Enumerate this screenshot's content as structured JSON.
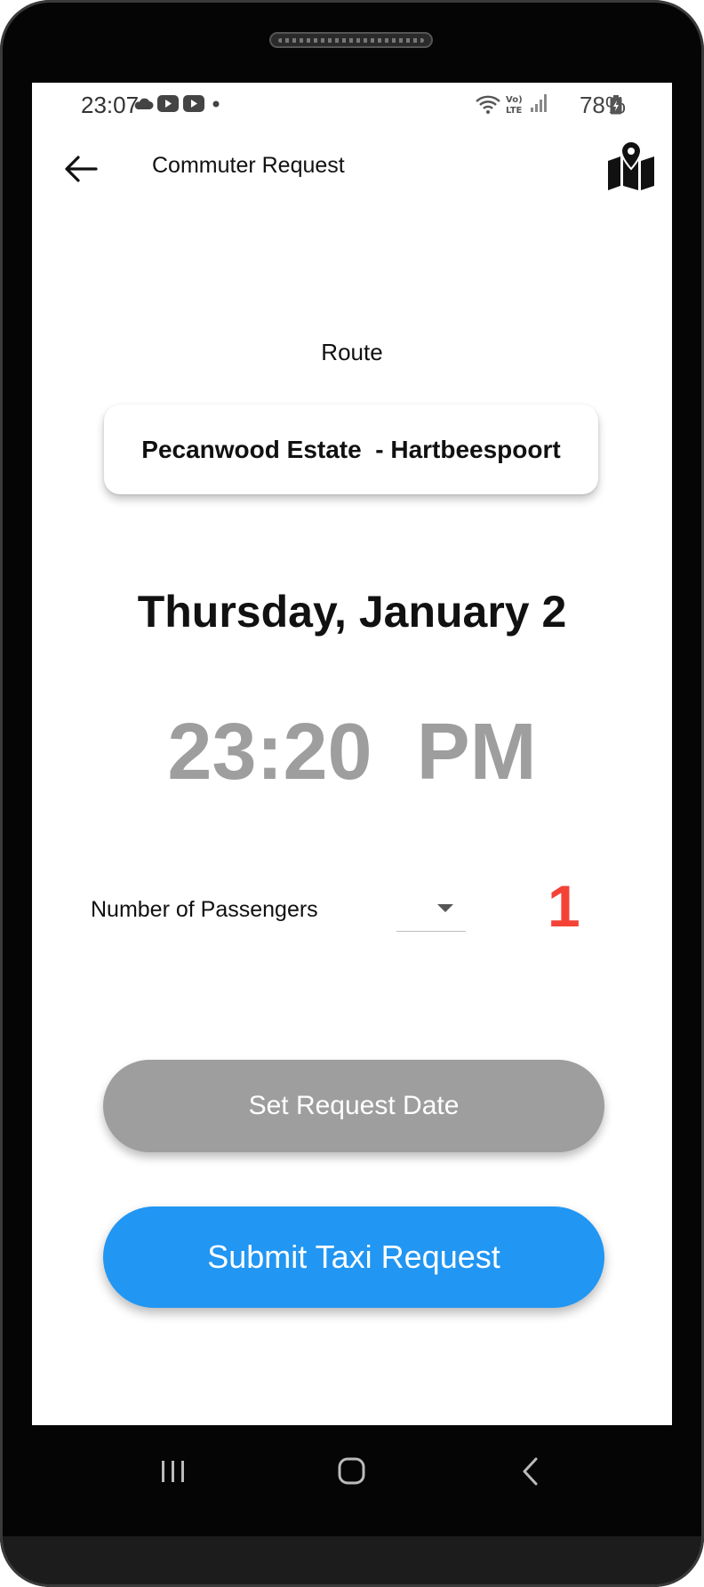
{
  "status_bar": {
    "time": "23:07",
    "battery": "78%",
    "icons": [
      "cloud-icon",
      "youtube-icon",
      "youtube-icon",
      "dot-icon",
      "wifi-icon",
      "volte-icon",
      "signal-icon",
      "battery-charging-icon"
    ]
  },
  "app_bar": {
    "title": "Commuter Request",
    "back_icon": "arrow-left-icon",
    "map_icon": "map-pin-icon"
  },
  "route": {
    "label": "Route",
    "value": "Pecanwood Estate  - Hartbeespoort"
  },
  "request": {
    "date": "Thursday, January 2",
    "time": "23:20  PM"
  },
  "passengers": {
    "label": "Number of Passengers",
    "count": "1"
  },
  "buttons": {
    "set_date": "Set Request Date",
    "submit": "Submit Taxi Request"
  },
  "colors": {
    "accent": "#2196f3",
    "disabled": "#9e9e9e",
    "count": "#f44336"
  },
  "nav_bar": {
    "icons": [
      "recents-icon",
      "home-icon",
      "back-nav-icon"
    ]
  }
}
